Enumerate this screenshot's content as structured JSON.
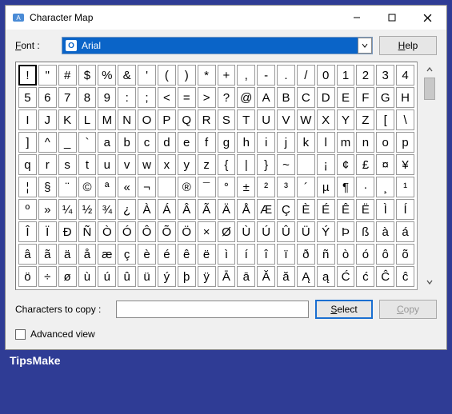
{
  "window": {
    "title": "Character Map"
  },
  "fontRow": {
    "label_pre": "F",
    "label_rest": "ont :",
    "selected": "Arial"
  },
  "help": {
    "pre": "H",
    "rest": "elp",
    "ul": "H"
  },
  "grid": {
    "rows": [
      [
        "!",
        "\"",
        "#",
        "$",
        "%",
        "&",
        "'",
        "(",
        ")",
        "*",
        "+",
        ",",
        "-",
        ".",
        "/",
        "0",
        "1",
        "2",
        "3",
        "4"
      ],
      [
        "5",
        "6",
        "7",
        "8",
        "9",
        ":",
        ";",
        "<",
        "=",
        ">",
        "?",
        "@",
        "A",
        "B",
        "C",
        "D",
        "E",
        "F",
        "G",
        "H"
      ],
      [
        "I",
        "J",
        "K",
        "L",
        "M",
        "N",
        "O",
        "P",
        "Q",
        "R",
        "S",
        "T",
        "U",
        "V",
        "W",
        "X",
        "Y",
        "Z",
        "[",
        "\\"
      ],
      [
        "]",
        "^",
        "_",
        "`",
        "a",
        "b",
        "c",
        "d",
        "e",
        "f",
        "g",
        "h",
        "i",
        "j",
        "k",
        "l",
        "m",
        "n",
        "o",
        "p"
      ],
      [
        "q",
        "r",
        "s",
        "t",
        "u",
        "v",
        "w",
        "x",
        "y",
        "z",
        "{",
        "|",
        "}",
        "~",
        "",
        "¡",
        "¢",
        "£",
        "¤",
        "¥"
      ],
      [
        "¦",
        "§",
        "¨",
        "©",
        "ª",
        "«",
        "¬",
        "",
        "®",
        "¯",
        "°",
        "±",
        "²",
        "³",
        "´",
        "µ",
        "¶",
        "·",
        "¸",
        "¹"
      ],
      [
        "º",
        "»",
        "¼",
        "½",
        "¾",
        "¿",
        "À",
        "Á",
        "Â",
        "Ã",
        "Ä",
        "Å",
        "Æ",
        "Ç",
        "È",
        "É",
        "Ê",
        "Ë",
        "Ì",
        "Í"
      ],
      [
        "Î",
        "Ï",
        "Ð",
        "Ñ",
        "Ò",
        "Ó",
        "Ô",
        "Õ",
        "Ö",
        "×",
        "Ø",
        "Ù",
        "Ú",
        "Û",
        "Ü",
        "Ý",
        "Þ",
        "ß",
        "à",
        "á"
      ],
      [
        "â",
        "ã",
        "ä",
        "å",
        "æ",
        "ç",
        "è",
        "é",
        "ê",
        "ë",
        "ì",
        "í",
        "î",
        "ï",
        "ð",
        "ñ",
        "ò",
        "ó",
        "ô",
        "õ"
      ],
      [
        "ö",
        "÷",
        "ø",
        "ù",
        "ú",
        "û",
        "ü",
        "ý",
        "þ",
        "ÿ",
        "Ā",
        "ā",
        "Ă",
        "ă",
        "Ą",
        "ą",
        "Ć",
        "ć",
        "Ĉ",
        "ĉ"
      ]
    ],
    "selected": {
      "row": 0,
      "col": 0
    }
  },
  "copyRow": {
    "label": "Characters to copy :",
    "value": "",
    "select_pre": "S",
    "select_rest": "elect",
    "copy_pre": "C",
    "copy_rest": "opy"
  },
  "advanced": {
    "checked": false,
    "label": "Advanced view"
  },
  "footer": {
    "brand": "TipsMake"
  }
}
